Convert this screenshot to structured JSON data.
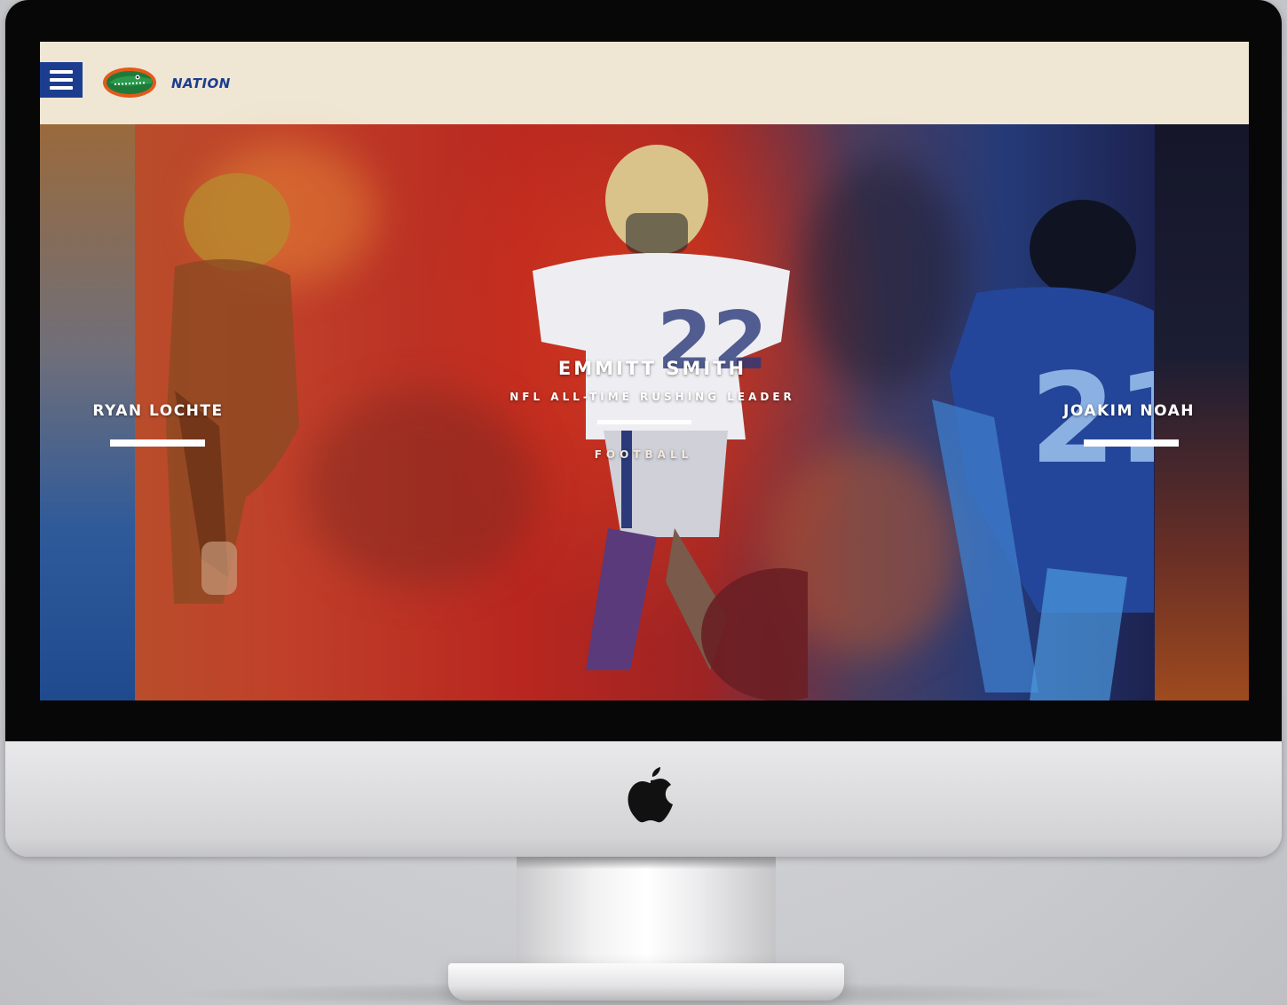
{
  "header": {
    "brand_name": "NATION",
    "menu_icon": "hamburger-menu-icon",
    "logo_icon": "gator-logo-icon",
    "accent_color": "#1c3d8f",
    "background_color": "#efe6d3"
  },
  "athletes": {
    "left": {
      "name": "RYAN LOCHTE"
    },
    "center": {
      "name": "EMMITT SMITH",
      "subtitle": "NFL ALL-TIME RUSHING LEADER",
      "sport": "FOOTBALL"
    },
    "right": {
      "name": "JOAKIM NOAH"
    }
  },
  "device": {
    "logo_icon": "apple-logo-icon"
  }
}
